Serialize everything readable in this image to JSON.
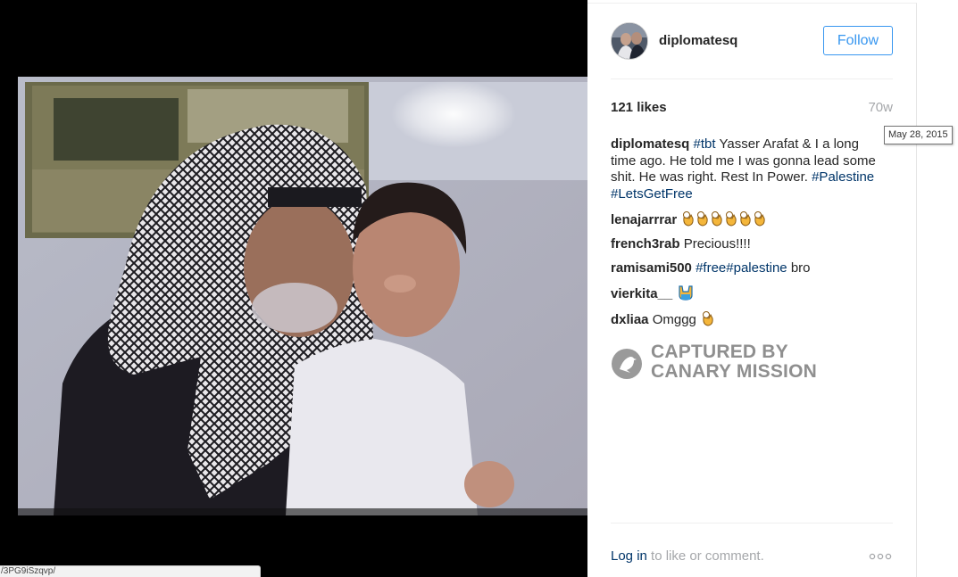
{
  "post": {
    "username": "diplomatesq",
    "follow_label": "Follow",
    "likes": "121 likes",
    "age": "70w",
    "date_tooltip": "May 28, 2015"
  },
  "caption": {
    "author": "diplomatesq",
    "hashtag_tbt": "#tbt",
    "text": " Yasser Arafat & I a long time ago. He told me I was gonna lead some shit. He was right. Rest In Power. ",
    "hashtag_palestine": "#Palestine",
    "hashtag_letsgetfree": "#LetsGetFree"
  },
  "comments": [
    {
      "author": "lenajarrrar",
      "text": "",
      "emoji": "ok-hand-emoji",
      "emoji_count": 6
    },
    {
      "author": "french3rab",
      "text": "Precious!!!!",
      "emoji": "",
      "emoji_count": 0
    },
    {
      "author": "ramisami500",
      "hashtag": "#free#palestine",
      "text": " bro",
      "emoji": "",
      "emoji_count": 0
    },
    {
      "author": "vierkita__",
      "text": "",
      "emoji": "raised-hands-emoji",
      "emoji_count": 1
    },
    {
      "author": "dxliaa",
      "text": "Omggg",
      "emoji": "ok-hand-emoji",
      "emoji_count": 1
    }
  ],
  "watermark": {
    "line1": "CAPTURED BY",
    "line2": "CANARY MISSION",
    "icon": "canary-bird-icon"
  },
  "footer": {
    "login_link": "Log in",
    "login_rest": " to like or comment.",
    "more_icon": "ellipsis-icon",
    "more_label": "ooo"
  },
  "status_bar": {
    "url": "/3PG9iSzqvp/"
  },
  "colors": {
    "link_blue": "#3897f0",
    "hashtag_navy": "#003569",
    "muted_gray": "#a5a7aa",
    "watermark_gray": "#8f8f8f"
  }
}
